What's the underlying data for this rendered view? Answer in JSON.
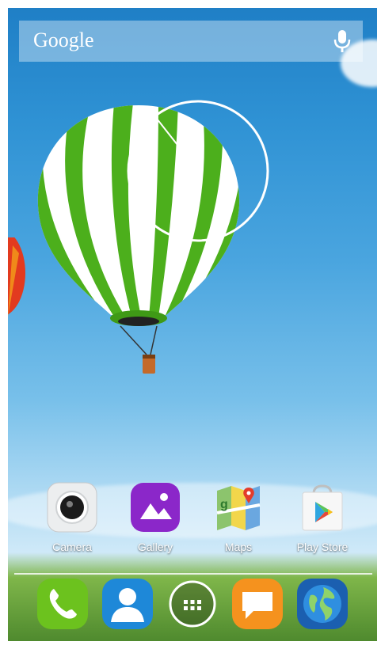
{
  "search": {
    "brand": "Google",
    "mic_icon": "microphone-icon"
  },
  "clock": {
    "type": "analog-clock-widget"
  },
  "apps": [
    {
      "label": "Camera",
      "icon": "camera-icon"
    },
    {
      "label": "Gallery",
      "icon": "gallery-icon"
    },
    {
      "label": "Maps",
      "icon": "maps-icon"
    },
    {
      "label": "Play Store",
      "icon": "play-store-icon"
    }
  ],
  "dock": [
    {
      "icon": "phone-icon"
    },
    {
      "icon": "contacts-icon"
    },
    {
      "icon": "app-drawer-icon"
    },
    {
      "icon": "messaging-icon"
    },
    {
      "icon": "browser-icon"
    }
  ],
  "colors": {
    "sky": "#2f92d4",
    "grass": "#5c9a34",
    "balloon_green": "#4cae1a",
    "dock_line": "#ffffff"
  }
}
